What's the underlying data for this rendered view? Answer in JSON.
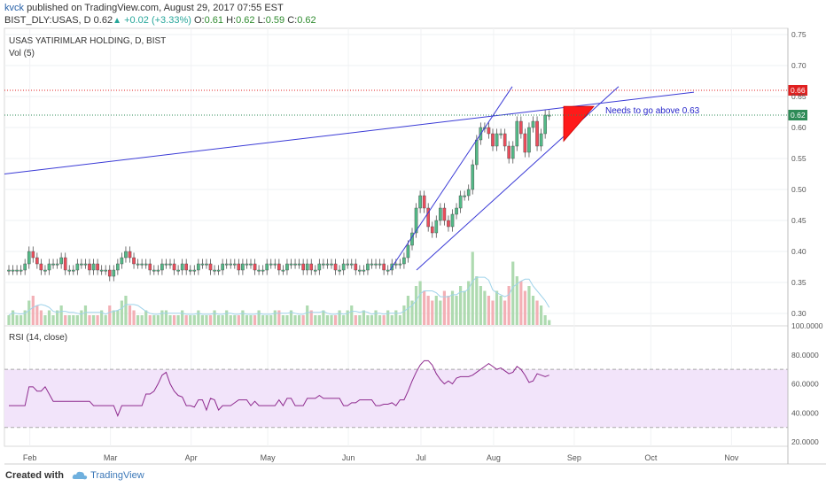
{
  "header": {
    "author": "kvck",
    "published": "published on TradingView.com, August 29, 2017 07:55 EST",
    "symbol": "BIST_DLY:USAS, D",
    "last": "0.62",
    "change": "+0.02 (+3.33%)",
    "o_label": "O:",
    "o": "0.61",
    "h_label": "H:",
    "h": "0.62",
    "l_label": "L:",
    "l": "0.59",
    "c_label": "C:",
    "c": "0.62"
  },
  "pane_labels": {
    "title": "USAS YATIRIMLAR HOLDING, D, BIST",
    "vol": "Vol (5)",
    "rsi": "RSI (14, close)"
  },
  "annotation": "Needs to go above 0.63",
  "footer": {
    "created_with": "Created with",
    "brand": "TradingView"
  },
  "colors": {
    "up": "#53b987",
    "down": "#eb4d5c",
    "trendline": "#3b3bd6",
    "resistance": "#e02020",
    "support_dotted": "#2e8b57",
    "rsi_line": "#8e2a8e",
    "rsi_band": "#f2e4fa",
    "triangle_fill": "#ff1a1a"
  },
  "chart_data": [
    {
      "type": "candlestick",
      "title": "USAS YATIRIMLAR HOLDING, D, BIST",
      "x_ticks": [
        "Feb",
        "Mar",
        "Apr",
        "May",
        "Jun",
        "Jul",
        "Aug",
        "Sep",
        "Oct",
        "Nov"
      ],
      "y_ticks": [
        "0.75",
        "0.70",
        "0.65",
        "0.60",
        "0.55",
        "0.50",
        "0.45",
        "0.40",
        "0.35",
        "0.30"
      ],
      "ylim": [
        0.28,
        0.76
      ],
      "price_labels": [
        {
          "value": 0.66,
          "text": "0.66",
          "color": "#e02020",
          "style": "dotted"
        },
        {
          "value": 0.62,
          "text": "0.62",
          "color": "#2e8b57",
          "style": "dotted"
        }
      ],
      "series": [
        {
          "name": "BIST_DLY:USAS",
          "close": [
            0.37,
            0.37,
            0.37,
            0.37,
            0.38,
            0.4,
            0.39,
            0.38,
            0.37,
            0.37,
            0.38,
            0.38,
            0.38,
            0.39,
            0.37,
            0.37,
            0.37,
            0.38,
            0.38,
            0.38,
            0.37,
            0.38,
            0.37,
            0.37,
            0.37,
            0.36,
            0.37,
            0.38,
            0.39,
            0.4,
            0.39,
            0.38,
            0.38,
            0.38,
            0.38,
            0.37,
            0.37,
            0.37,
            0.38,
            0.38,
            0.38,
            0.37,
            0.37,
            0.38,
            0.37,
            0.37,
            0.37,
            0.38,
            0.38,
            0.38,
            0.37,
            0.37,
            0.37,
            0.38,
            0.38,
            0.38,
            0.38,
            0.37,
            0.38,
            0.38,
            0.38,
            0.37,
            0.37,
            0.37,
            0.38,
            0.38,
            0.38,
            0.37,
            0.37,
            0.38,
            0.38,
            0.38,
            0.38,
            0.37,
            0.38,
            0.37,
            0.37,
            0.38,
            0.38,
            0.38,
            0.38,
            0.37,
            0.37,
            0.38,
            0.38,
            0.38,
            0.37,
            0.37,
            0.37,
            0.38,
            0.38,
            0.38,
            0.38,
            0.37,
            0.37,
            0.38,
            0.38,
            0.38,
            0.39,
            0.41,
            0.43,
            0.47,
            0.49,
            0.47,
            0.44,
            0.43,
            0.45,
            0.47,
            0.45,
            0.44,
            0.46,
            0.47,
            0.49,
            0.49,
            0.5,
            0.54,
            0.58,
            0.6,
            0.6,
            0.59,
            0.57,
            0.59,
            0.59,
            0.57,
            0.55,
            0.57,
            0.61,
            0.59,
            0.56,
            0.6,
            0.61,
            0.57,
            0.59,
            0.62,
            0.62
          ]
        },
        {
          "name": "Vol (5)",
          "values": [
            2,
            3,
            2,
            2,
            3,
            5,
            6,
            4,
            3,
            2,
            3,
            2,
            3,
            4,
            2,
            2,
            2,
            2,
            3,
            4,
            2,
            2,
            2,
            3,
            2,
            4,
            3,
            3,
            5,
            6,
            4,
            3,
            2,
            2,
            3,
            2,
            2,
            2,
            3,
            3,
            2,
            2,
            2,
            3,
            2,
            2,
            2,
            3,
            2,
            2,
            2,
            3,
            2,
            2,
            3,
            2,
            2,
            2,
            3,
            2,
            2,
            2,
            3,
            2,
            2,
            2,
            3,
            3,
            2,
            2,
            3,
            2,
            2,
            2,
            4,
            3,
            2,
            2,
            3,
            2,
            2,
            2,
            3,
            2,
            3,
            4,
            2,
            2,
            3,
            2,
            2,
            3,
            2,
            2,
            3,
            2,
            3,
            2,
            4,
            6,
            5,
            8,
            9,
            7,
            6,
            5,
            6,
            5,
            7,
            6,
            7,
            6,
            8,
            7,
            9,
            15,
            10,
            8,
            7,
            6,
            5,
            7,
            6,
            5,
            8,
            13,
            10,
            9,
            7,
            8,
            6,
            5,
            4,
            2,
            1
          ]
        }
      ]
    },
    {
      "type": "line",
      "title": "RSI (14, close)",
      "x_ticks": [
        "Feb",
        "Mar",
        "Apr",
        "May",
        "Jun",
        "Jul",
        "Aug",
        "Sep",
        "Oct",
        "Nov"
      ],
      "y_ticks": [
        "100.0000",
        "80.0000",
        "60.0000",
        "40.0000",
        "20.0000"
      ],
      "ylim": [
        17,
        100
      ],
      "band": [
        30,
        70
      ],
      "series": [
        {
          "name": "RSI (14, close)",
          "values": [
            45,
            45,
            45,
            45,
            45,
            58,
            58,
            55,
            55,
            58,
            53,
            48,
            48,
            48,
            48,
            48,
            48,
            48,
            48,
            48,
            48,
            45,
            45,
            45,
            45,
            45,
            45,
            38,
            45,
            45,
            45,
            45,
            45,
            45,
            53,
            53,
            55,
            60,
            66,
            68,
            60,
            55,
            52,
            51,
            45,
            45,
            44,
            49,
            49,
            42,
            50,
            49,
            42,
            45,
            45,
            45,
            47,
            49,
            49,
            49,
            45,
            48,
            45,
            45,
            45,
            45,
            45,
            49,
            45,
            50,
            50,
            45,
            45,
            45,
            50,
            50,
            50,
            52,
            50,
            50,
            50,
            50,
            50,
            45,
            45,
            47,
            47,
            49,
            49,
            49,
            49,
            45,
            45,
            46,
            46,
            47,
            45,
            49,
            49,
            55,
            62,
            68,
            73,
            76,
            76,
            73,
            67,
            63,
            60,
            62,
            60,
            64,
            65,
            65,
            65,
            66,
            68,
            70,
            72,
            74,
            72,
            70,
            71,
            69,
            67,
            68,
            72,
            70,
            66,
            61,
            62,
            67,
            66,
            65,
            66
          ]
        }
      ]
    }
  ]
}
